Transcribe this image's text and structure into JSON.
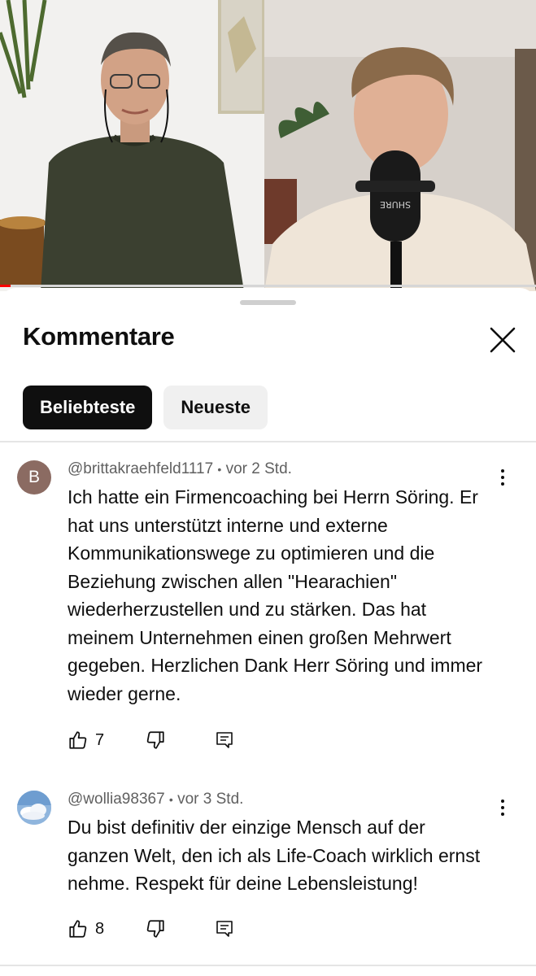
{
  "sheet": {
    "title": "Kommentare",
    "filters": [
      "Beliebteste",
      "Neueste"
    ],
    "active_filter": "Beliebteste"
  },
  "video": {
    "progress": 0.02
  },
  "colors": {
    "accent": "#0f0f0f",
    "progress": "#ff0000",
    "avatar_b": "#8b6b62"
  },
  "comments": [
    {
      "avatar_letter": "B",
      "author": "@brittakraehfeld1117",
      "separator": "•",
      "time": "vor 2 Std.",
      "lines": [
        "Ich hatte ein Firmencoaching bei Herrn Söring. Er",
        "hat uns unterstützt interne und externe",
        "Kommunikationswege zu optimieren und die",
        "Beziehung zwischen allen \"Hearachien\"",
        "wiederherzustellen und zu stärken. Das hat",
        "meinem Unternehmen einen großen Mehrwert",
        "gegeben. Herzlichen Dank Herr Söring und immer",
        "wieder gerne."
      ],
      "likes": "7"
    },
    {
      "avatar_letter": "",
      "author": "@wollia98367",
      "separator": "•",
      "time": "vor 3 Std.",
      "lines": [
        "Du bist definitiv der einzige Mensch auf der",
        "ganzen Welt, den ich als Life-Coach wirklich ernst",
        "nehme. Respekt für deine Lebensleistung!"
      ],
      "likes": "8"
    }
  ]
}
